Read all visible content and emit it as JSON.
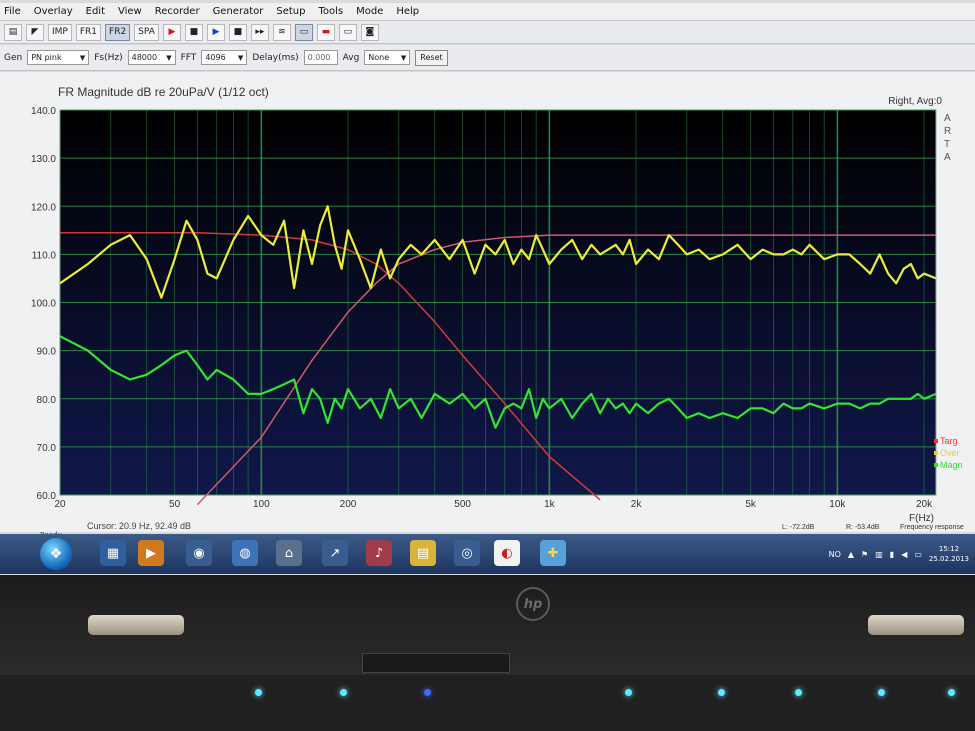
{
  "menu": [
    "File",
    "Overlay",
    "Edit",
    "View",
    "Recorder",
    "Generator",
    "Setup",
    "Tools",
    "Mode",
    "Help"
  ],
  "toolbar1": {
    "buttons": [
      {
        "name": "open-button",
        "label": ""
      },
      {
        "name": "save-button",
        "label": ""
      },
      {
        "name": "imp-button",
        "label": "IMP"
      },
      {
        "name": "fr1-button",
        "label": "FR1"
      },
      {
        "name": "fr2-button",
        "label": "FR2",
        "active": true
      },
      {
        "name": "spa-button",
        "label": "SPA"
      }
    ]
  },
  "toolbar2": {
    "gen_label": "Gen",
    "gen_value": "PN pink",
    "fs_label": "Fs(Hz)",
    "fs_value": "48000",
    "fft_label": "FFT",
    "fft_value": "4096",
    "delay_label": "Delay(ms)",
    "delay_value": "0.000",
    "avg_label": "Avg",
    "avg_value": "None",
    "reset_label": "Reset"
  },
  "chart_data": {
    "type": "line",
    "title": "FR Magnitude dB re 20uPa/V (1/12 oct)",
    "right_label": "Right, Avg:0",
    "side_letters": [
      "A",
      "R",
      "T",
      "A"
    ],
    "xlabel": "F(Hz)",
    "xscale": "log",
    "xlim": [
      20,
      22000
    ],
    "ylim": [
      60,
      140
    ],
    "x_ticks": [
      {
        "v": 20,
        "t": "20"
      },
      {
        "v": 50,
        "t": "50"
      },
      {
        "v": 100,
        "t": "100"
      },
      {
        "v": 200,
        "t": "200"
      },
      {
        "v": 500,
        "t": "500"
      },
      {
        "v": 1000,
        "t": "1k"
      },
      {
        "v": 2000,
        "t": "2k"
      },
      {
        "v": 5000,
        "t": "5k"
      },
      {
        "v": 10000,
        "t": "10k"
      },
      {
        "v": 20000,
        "t": "20k"
      }
    ],
    "y_ticks": [
      "140.0",
      "130.0",
      "120.0",
      "110.0",
      "100.0",
      "90.0",
      "80.0",
      "70.0",
      "60.0"
    ],
    "legend": [
      {
        "name": "Targ",
        "color": "#ff3030"
      },
      {
        "name": "Over",
        "color": "#e0d040"
      },
      {
        "name": "Magn",
        "color": "#30e030"
      }
    ],
    "series": [
      {
        "name": "Targ",
        "color": "#d23a3a",
        "x": [
          20,
          60,
          100,
          150,
          200,
          250,
          300,
          400,
          500,
          700,
          1000,
          1500
        ],
        "y": [
          114.5,
          114.5,
          114,
          113,
          111,
          108,
          104,
          96,
          89,
          79,
          68,
          59
        ]
      },
      {
        "name": "Over",
        "color": "#cf5a6a",
        "x": [
          60,
          100,
          150,
          200,
          250,
          300,
          400,
          500,
          700,
          1000,
          2000,
          5000,
          10000,
          22000
        ],
        "y": [
          58,
          72,
          88,
          98,
          104,
          108,
          111,
          112.5,
          113.5,
          114,
          114,
          114,
          114,
          114
        ]
      },
      {
        "name": "Magn-yellow",
        "color": "#ecec3c",
        "x": [
          20,
          25,
          30,
          35,
          40,
          45,
          50,
          55,
          60,
          65,
          70,
          80,
          90,
          100,
          110,
          120,
          130,
          140,
          150,
          160,
          170,
          180,
          190,
          200,
          220,
          240,
          260,
          280,
          300,
          330,
          360,
          400,
          450,
          500,
          550,
          600,
          650,
          700,
          750,
          800,
          850,
          900,
          950,
          1000,
          1100,
          1200,
          1300,
          1400,
          1500,
          1600,
          1700,
          1800,
          1900,
          2000,
          2200,
          2400,
          2600,
          2800,
          3000,
          3300,
          3600,
          4000,
          4500,
          5000,
          5500,
          6000,
          6500,
          7000,
          7500,
          8000,
          9000,
          10000,
          11000,
          12000,
          13000,
          14000,
          15000,
          16000,
          17000,
          18000,
          19000,
          20000,
          22000
        ],
        "y": [
          104,
          108,
          112,
          114,
          109,
          101,
          109,
          117,
          113,
          106,
          105,
          113,
          118,
          114,
          112,
          117,
          103,
          115,
          108,
          116,
          120,
          112,
          107,
          115,
          109,
          103,
          111,
          105,
          109,
          112,
          110,
          113,
          109,
          113,
          106,
          112,
          110,
          113,
          108,
          111,
          109,
          114,
          111,
          108,
          111,
          113,
          109,
          112,
          110,
          111,
          112,
          110,
          113,
          108,
          111,
          109,
          114,
          112,
          110,
          111,
          109,
          110,
          112,
          109,
          111,
          110,
          110,
          111,
          110,
          112,
          109,
          110,
          110,
          108,
          106,
          110,
          106,
          104,
          107,
          108,
          105,
          106,
          105
        ]
      },
      {
        "name": "Magn-green",
        "color": "#30e630",
        "x": [
          20,
          25,
          30,
          35,
          40,
          45,
          50,
          55,
          60,
          65,
          70,
          80,
          90,
          100,
          110,
          120,
          130,
          140,
          150,
          160,
          170,
          180,
          190,
          200,
          220,
          240,
          260,
          280,
          300,
          330,
          360,
          400,
          450,
          500,
          550,
          600,
          650,
          700,
          750,
          800,
          850,
          900,
          950,
          1000,
          1100,
          1200,
          1300,
          1400,
          1500,
          1600,
          1700,
          1800,
          1900,
          2000,
          2200,
          2400,
          2600,
          2800,
          3000,
          3300,
          3600,
          4000,
          4500,
          5000,
          5500,
          6000,
          6500,
          7000,
          7500,
          8000,
          9000,
          10000,
          11000,
          12000,
          13000,
          14000,
          15000,
          16000,
          17000,
          18000,
          19000,
          20000,
          22000
        ],
        "y": [
          93,
          90,
          86,
          84,
          85,
          87,
          89,
          90,
          87,
          84,
          86,
          84,
          81,
          81,
          82,
          83,
          84,
          77,
          82,
          80,
          75,
          80,
          78,
          82,
          78,
          80,
          76,
          82,
          78,
          80,
          76,
          81,
          79,
          81,
          78,
          80,
          74,
          78,
          79,
          78,
          82,
          76,
          80,
          78,
          80,
          76,
          79,
          81,
          77,
          80,
          78,
          79,
          77,
          79,
          77,
          79,
          80,
          78,
          76,
          77,
          76,
          77,
          76,
          78,
          78,
          77,
          79,
          78,
          78,
          79,
          78,
          79,
          79,
          78,
          79,
          79,
          80,
          80,
          80,
          80,
          81,
          80,
          81
        ]
      }
    ]
  },
  "cursor_text": "Cursor:   20.9 Hz, 92.49 dB",
  "level_l": "L: -72.2dB",
  "level_r": "R: -53.4dB",
  "status_right": "Frequency response",
  "status_ready": "Ready",
  "tray": {
    "lang": "NO",
    "time": "15:12",
    "date": "25.02.2013"
  }
}
